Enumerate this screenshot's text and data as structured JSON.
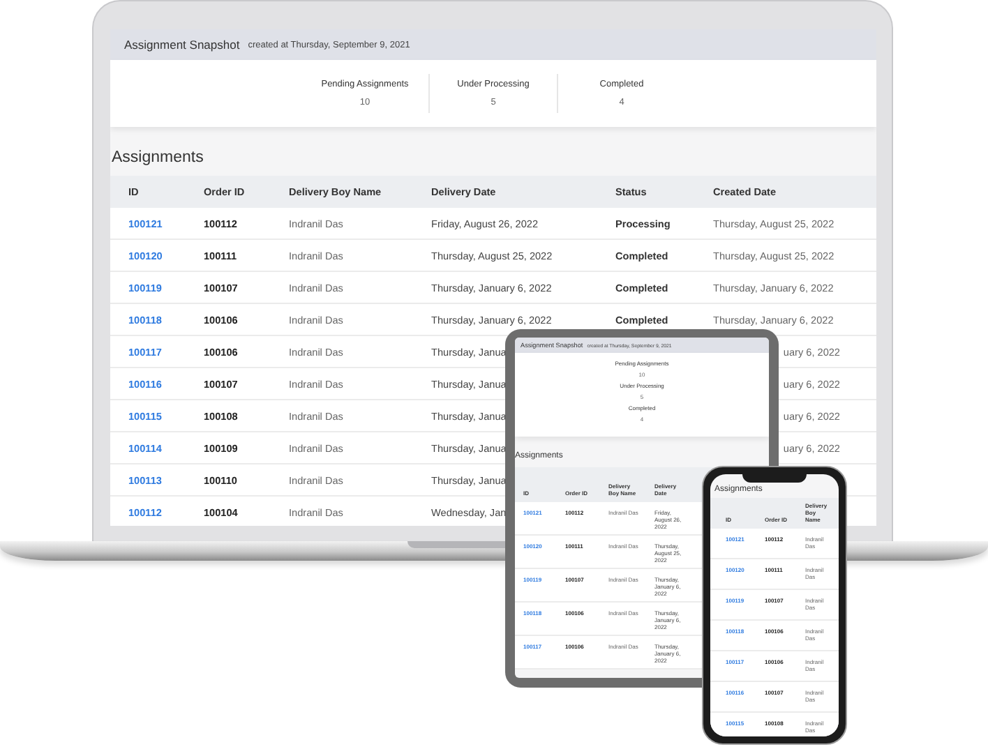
{
  "laptop": {
    "snapshot": {
      "title": "Assignment Snapshot",
      "created": "created at Thursday, September 9, 2021"
    },
    "stats": [
      {
        "label": "Pending Assignments",
        "value": "10"
      },
      {
        "label": "Under Processing",
        "value": "5"
      },
      {
        "label": "Completed",
        "value": "4"
      }
    ],
    "section_title": "Assignments",
    "columns": [
      "ID",
      "Order ID",
      "Delivery Boy Name",
      "Delivery Date",
      "Status",
      "Created Date"
    ],
    "rows": [
      {
        "id": "100121",
        "order_id": "100112",
        "name": "Indranil Das",
        "delivery_date": "Friday, August 26, 2022",
        "status": "Processing",
        "created_date": "Thursday, August 25, 2022"
      },
      {
        "id": "100120",
        "order_id": "100111",
        "name": "Indranil Das",
        "delivery_date": "Thursday, August 25, 2022",
        "status": "Completed",
        "created_date": "Thursday, August 25, 2022"
      },
      {
        "id": "100119",
        "order_id": "100107",
        "name": "Indranil Das",
        "delivery_date": "Thursday, January 6, 2022",
        "status": "Completed",
        "created_date": "Thursday, January 6, 2022"
      },
      {
        "id": "100118",
        "order_id": "100106",
        "name": "Indranil Das",
        "delivery_date": "Thursday, January 6, 2022",
        "status": "Completed",
        "created_date": "Thursday, January 6, 2022"
      },
      {
        "id": "100117",
        "order_id": "100106",
        "name": "Indranil Das",
        "delivery_date": "Thursday, Janua",
        "created_date": "uary 6, 2022"
      },
      {
        "id": "100116",
        "order_id": "100107",
        "name": "Indranil Das",
        "delivery_date": "Thursday, Janua",
        "created_date": "uary 6, 2022"
      },
      {
        "id": "100115",
        "order_id": "100108",
        "name": "Indranil Das",
        "delivery_date": "Thursday, Janua",
        "created_date": "uary 6, 2022"
      },
      {
        "id": "100114",
        "order_id": "100109",
        "name": "Indranil Das",
        "delivery_date": "Thursday, Janua",
        "created_date": "uary 6, 2022"
      },
      {
        "id": "100113",
        "order_id": "100110",
        "name": "Indranil Das",
        "delivery_date": "Thursday, Janua"
      },
      {
        "id": "100112",
        "order_id": "100104",
        "name": "Indranil Das",
        "delivery_date": "Wednesday, Jan"
      }
    ]
  },
  "tablet": {
    "snapshot": {
      "title": "Assignment Snapshot",
      "created": "created at Thursday, September 9, 2021"
    },
    "stats": [
      {
        "label": "Pending Assignments",
        "value": "10"
      },
      {
        "label": "Under Processing",
        "value": "5"
      },
      {
        "label": "Completed",
        "value": "4"
      }
    ],
    "section_title": "Assignments",
    "columns": [
      "ID",
      "Order ID",
      "Delivery Boy Name",
      "Delivery Date"
    ],
    "rows": [
      {
        "id": "100121",
        "order_id": "100112",
        "name": "Indranil Das",
        "delivery_date": "Friday, August 26, 2022"
      },
      {
        "id": "100120",
        "order_id": "100111",
        "name": "Indranil Das",
        "delivery_date": "Thursday, August 25, 2022"
      },
      {
        "id": "100119",
        "order_id": "100107",
        "name": "Indranil Das",
        "delivery_date": "Thursday, January 6, 2022"
      },
      {
        "id": "100118",
        "order_id": "100106",
        "name": "Indranil Das",
        "delivery_date": "Thursday, January 6, 2022"
      },
      {
        "id": "100117",
        "order_id": "100106",
        "name": "Indranil Das",
        "delivery_date": "Thursday, January 6, 2022"
      }
    ]
  },
  "phone": {
    "section_title": "Assignments",
    "columns": [
      "ID",
      "Order ID",
      "Delivery Boy Name"
    ],
    "rows": [
      {
        "id": "100121",
        "order_id": "100112",
        "name": "Indranil Das"
      },
      {
        "id": "100120",
        "order_id": "100111",
        "name": "Indranil Das"
      },
      {
        "id": "100119",
        "order_id": "100107",
        "name": "Indranil Das"
      },
      {
        "id": "100118",
        "order_id": "100106",
        "name": "Indranil Das"
      },
      {
        "id": "100117",
        "order_id": "100106",
        "name": "Indranil Das"
      },
      {
        "id": "100116",
        "order_id": "100107",
        "name": "Indranil Das"
      },
      {
        "id": "100115",
        "order_id": "100108",
        "name": "Indranil Das"
      }
    ]
  }
}
